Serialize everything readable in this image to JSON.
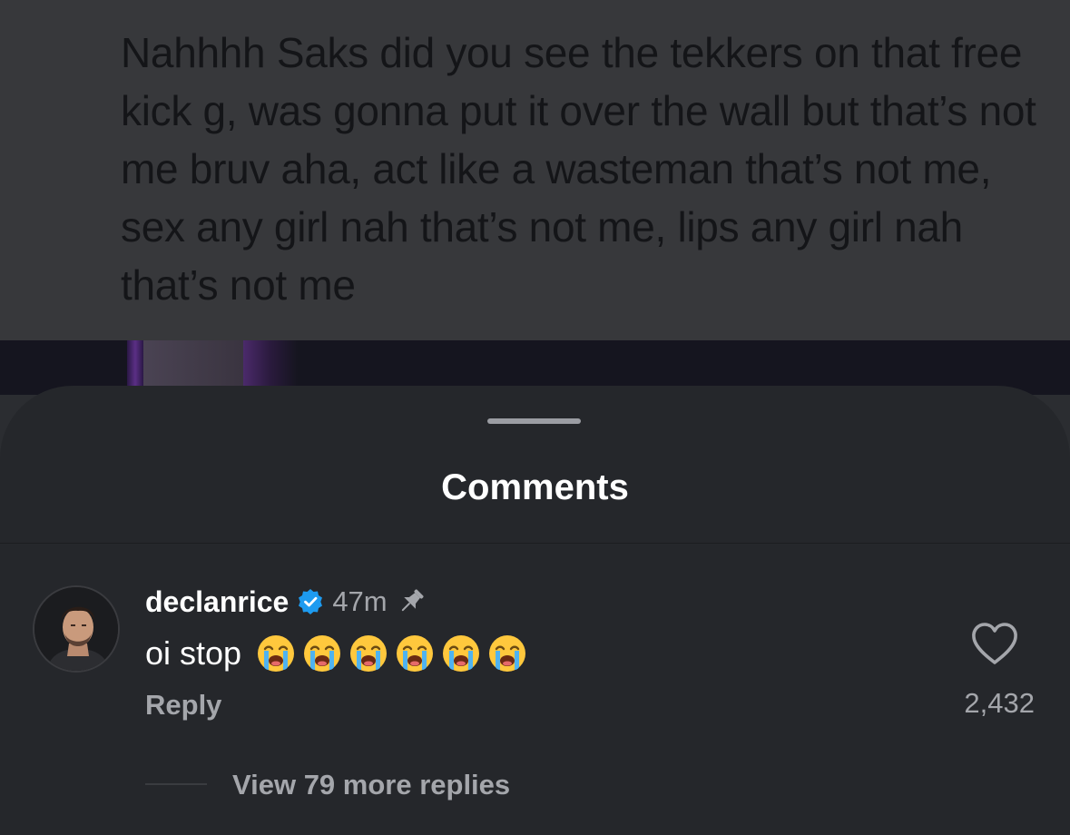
{
  "post": {
    "caption": "Nahhhh Saks did you see the tekkers on that free kick g, was gonna put it over the wall but that’s not me bruv aha, act like a wasteman that’s not me, sex any girl nah that’s not me, lips any girl nah that’s not me"
  },
  "sheet": {
    "title": "Comments"
  },
  "comment": {
    "username": "declanrice",
    "verified": true,
    "timestamp": "47m",
    "pinned": true,
    "text": "oi stop",
    "emoji": [
      "loudly-crying-face",
      "loudly-crying-face",
      "loudly-crying-face",
      "loudly-crying-face",
      "loudly-crying-face",
      "loudly-crying-face"
    ],
    "reply_label": "Reply",
    "like_count": "2,432",
    "view_replies_label": "View 79 more replies"
  },
  "colors": {
    "verified_blue": "#1d9bf0",
    "sheet_bg": "#25272b",
    "muted_text": "#a4a6ab"
  }
}
